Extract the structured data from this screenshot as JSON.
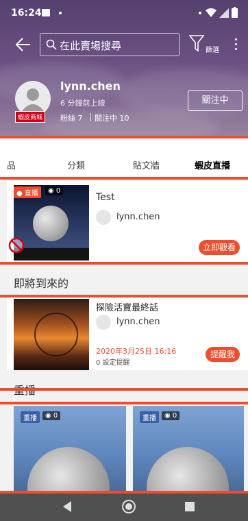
{
  "status_bar": {
    "time": "16:24"
  },
  "header": {
    "search_placeholder": "在此賣場搜尋",
    "filter_label": "篩選",
    "username": "lynn.chen",
    "last_online": "6 分鐘前上線",
    "shop_badge": "蝦皮商城",
    "followers_label": "粉絲 7",
    "following_label": "關注中 10",
    "follow_button": "關注中"
  },
  "tabs": [
    "品",
    "分類",
    "貼文牆",
    "蝦皮直播"
  ],
  "live_card": {
    "tag": "● 直播",
    "viewers": "0",
    "title": "Test",
    "host": "lynn.chen",
    "watch_button": "立即觀看"
  },
  "upcoming": {
    "section_title": "即將到來的",
    "title": "探險活寶最終話",
    "host": "lynn.chen",
    "datetime": "2020年3月25日 16:16",
    "reminders": "0 設定提醒",
    "remind_button": "提醒我"
  },
  "replay": {
    "section_title": "重播",
    "items": [
      {
        "tag": "重播",
        "viewers": "0"
      },
      {
        "tag": "重播",
        "viewers": "0"
      }
    ]
  },
  "colors": {
    "accent": "#ee4d2d",
    "shop_badge": "#d0011b"
  }
}
